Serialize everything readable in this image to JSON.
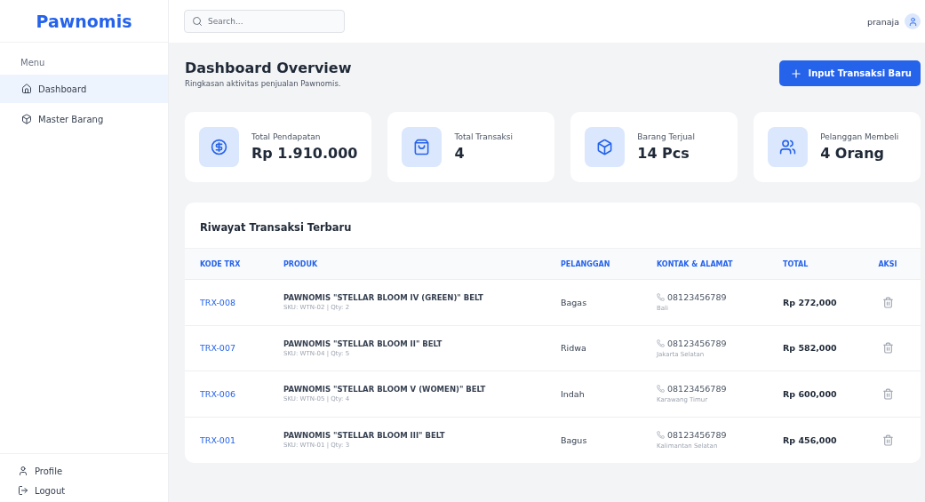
{
  "brand": "Pawnomis",
  "sidebar": {
    "heading": "Menu",
    "items": [
      {
        "label": "Dashboard",
        "kind": "home",
        "selected": true
      },
      {
        "label": "Master Barang",
        "kind": "box",
        "selected": false
      }
    ],
    "footer": [
      {
        "label": "Profile",
        "kind": "user"
      },
      {
        "label": "Logout",
        "kind": "logout"
      }
    ]
  },
  "topbar": {
    "search": {
      "placeholder": "Search..."
    },
    "user": "pranaja"
  },
  "page": {
    "title": "Dashboard Overview",
    "subtitle": "Ringkasan aktivitas penjualan Pawnomis.",
    "action": "Input Transaksi Baru"
  },
  "stats": [
    {
      "kind": "money",
      "label": "Total Pendapatan",
      "value": "Rp 1.910.000"
    },
    {
      "kind": "bag",
      "label": "Total Transaksi",
      "value": "4"
    },
    {
      "kind": "box",
      "label": "Barang Terjual",
      "value": "14 Pcs"
    },
    {
      "kind": "people",
      "label": "Pelanggan Membeli",
      "value": "4 Orang"
    }
  ],
  "table": {
    "title": "Riwayat Transaksi Terbaru",
    "columns": [
      "KODE TRX",
      "PRODUK",
      "PELANGGAN",
      "KONTAK & ALAMAT",
      "TOTAL",
      "AKSI"
    ],
    "rows": [
      {
        "code": "TRX-008",
        "product": "PAWNOMIS \"STELLAR BLOOM IV (GREEN)\" BELT",
        "meta": "SKU: WTN-02 | Qty: 2",
        "customer": "Bagas",
        "phone": "08123456789",
        "address": "Bali",
        "total": "Rp 272,000"
      },
      {
        "code": "TRX-007",
        "product": "PAWNOMIS \"STELLAR BLOOM II\" BELT",
        "meta": "SKU: WTN-04 | Qty: 5",
        "customer": "Ridwa",
        "phone": "08123456789",
        "address": "Jakarta Selatan",
        "total": "Rp 582,000"
      },
      {
        "code": "TRX-006",
        "product": "PAWNOMIS \"STELLAR BLOOM V (WOMEN)\" BELT",
        "meta": "SKU: WTN-05 | Qty: 4",
        "customer": "Indah",
        "phone": "08123456789",
        "address": "Karawang Timur",
        "total": "Rp 600,000"
      },
      {
        "code": "TRX-001",
        "product": "PAWNOMIS \"STELLAR BLOOM III\" BELT",
        "meta": "SKU: WTN-01 | Qty: 3",
        "customer": "Bagus",
        "phone": "08123456789",
        "address": "Kalimantan Selatan",
        "total": "Rp 456,000"
      }
    ]
  }
}
